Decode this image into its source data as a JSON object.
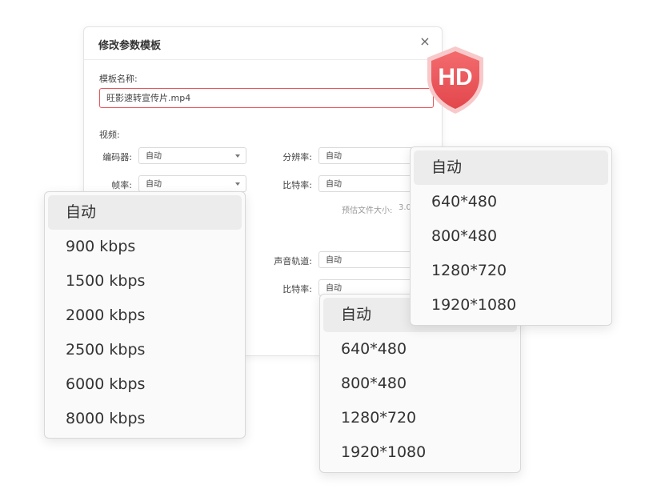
{
  "dialog": {
    "title": "修改参数模板",
    "close_glyph": "×",
    "template_name_label": "模板名称:",
    "template_name_value": "旺影速转宣传片.mp4",
    "video_section_label": "视频:",
    "encoder_label": "编码器:",
    "encoder_value": "自动",
    "resolution_label": "分辨率:",
    "resolution_value": "自动",
    "framerate_label": "帧率:",
    "framerate_value": "自动",
    "video_bitrate_label": "比特率:",
    "video_bitrate_value": "自动",
    "estimated_size_label": "预估文件大小:",
    "estimated_size_value": "3.0",
    "audio_channel_label": "声音轨道:",
    "audio_channel_value": "自动",
    "audio_bitrate_label": "比特率:",
    "audio_bitrate_value": "自动"
  },
  "badge": {
    "text": "HD",
    "color": "#f0575b"
  },
  "bitrate_menu": {
    "items": [
      "自动",
      "900 kbps",
      "1500 kbps",
      "2000 kbps",
      "2500 kbps",
      "6000 kbps",
      "8000 kbps"
    ],
    "selected": "自动"
  },
  "resolution_menu_top": {
    "items": [
      "自动",
      "640*480",
      "800*480",
      "1280*720",
      "1920*1080"
    ],
    "selected": "自动"
  },
  "resolution_menu_bottom": {
    "items": [
      "自动",
      "640*480",
      "800*480",
      "1280*720",
      "1920*1080"
    ],
    "selected": "自动"
  },
  "colors": {
    "accent_red": "#e8565a",
    "menu_bg": "#fafafa",
    "menu_active": "#ececec"
  }
}
